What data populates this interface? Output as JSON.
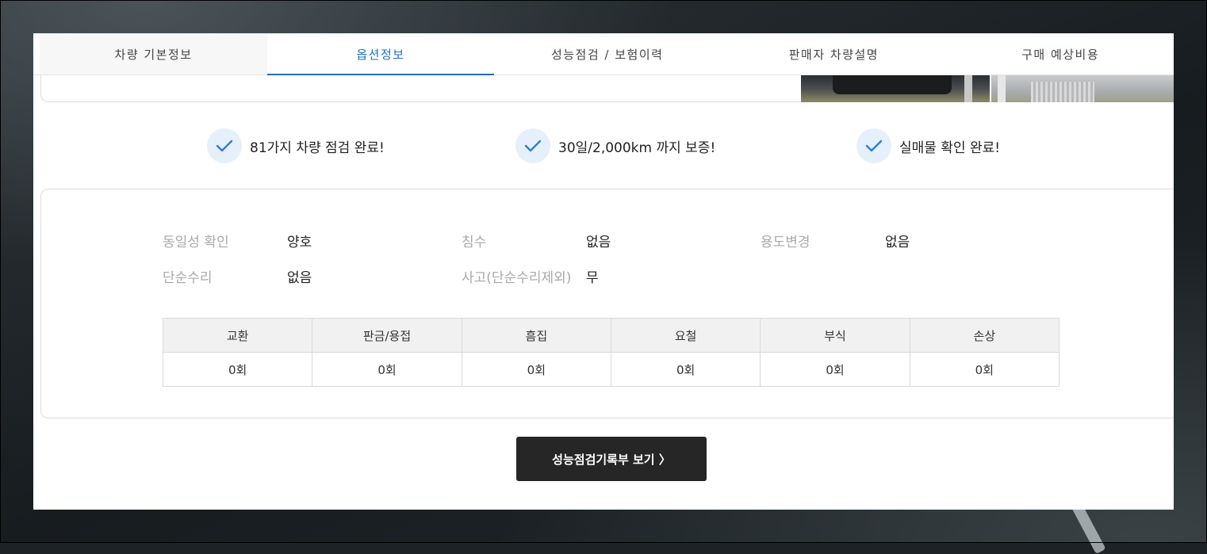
{
  "tabs": [
    {
      "label": "차량 기본정보"
    },
    {
      "label": "옵션정보"
    },
    {
      "label": "성능점검 / 보험이력"
    },
    {
      "label": "판매자 차량설명"
    },
    {
      "label": "구매 예상비용"
    }
  ],
  "active_tab": "옵션정보",
  "accent_color": "#1f6fc4",
  "guarantees": [
    {
      "icon": "check-icon",
      "text": "81가지 차량 점검 완료!"
    },
    {
      "icon": "check-icon",
      "text": "30일/2,000km 까지 보증!"
    },
    {
      "icon": "check-icon",
      "text": "실매물 확인 완료!"
    }
  ],
  "info": {
    "identity": {
      "label": "동일성 확인",
      "value": "양호"
    },
    "flood": {
      "label": "침수",
      "value": "없음"
    },
    "usage_change": {
      "label": "용도변경",
      "value": "없음"
    },
    "simple_repair": {
      "label": "단순수리",
      "value": "없음"
    },
    "accident": {
      "label": "사고(단순수리제외)",
      "value": "무"
    }
  },
  "repair_table": {
    "headers": [
      "교환",
      "판금/용접",
      "흠집",
      "요철",
      "부식",
      "손상"
    ],
    "values": [
      "0회",
      "0회",
      "0회",
      "0회",
      "0회",
      "0회"
    ]
  },
  "cta": {
    "label": "성능점검기록부 보기 〉"
  }
}
